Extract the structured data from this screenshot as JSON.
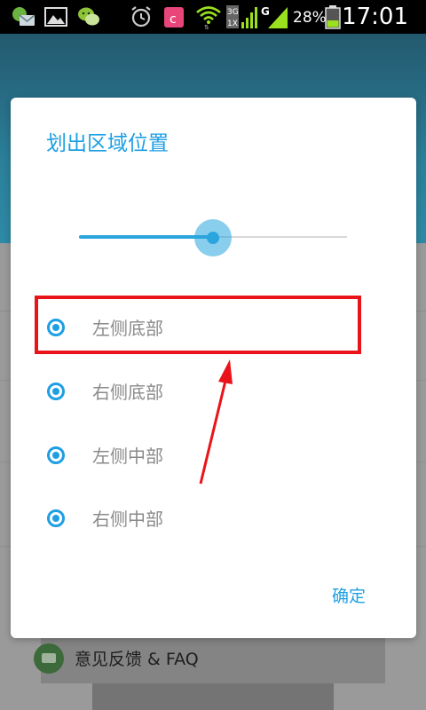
{
  "status_bar": {
    "time": "17:01",
    "battery": "28%",
    "network_labels": [
      "3G",
      "1X",
      "G"
    ],
    "icons": [
      "sms-notification-icon",
      "gallery-icon",
      "wechat-icon",
      "alarm-icon",
      "app-c-icon",
      "wifi-icon",
      "signal-3g-icon",
      "signal-g-icon",
      "battery-icon"
    ]
  },
  "background": {
    "feedback_label": "意见反馈 & FAQ"
  },
  "dialog": {
    "title": "划出区域位置",
    "slider": {
      "value": 0.5
    },
    "options": [
      {
        "label": "左侧底部"
      },
      {
        "label": "右侧底部"
      },
      {
        "label": "左侧中部"
      },
      {
        "label": "右侧中部"
      }
    ],
    "ok_label": "确定"
  },
  "colors": {
    "accent": "#1e9fe3",
    "annotation": "#e8141a"
  }
}
